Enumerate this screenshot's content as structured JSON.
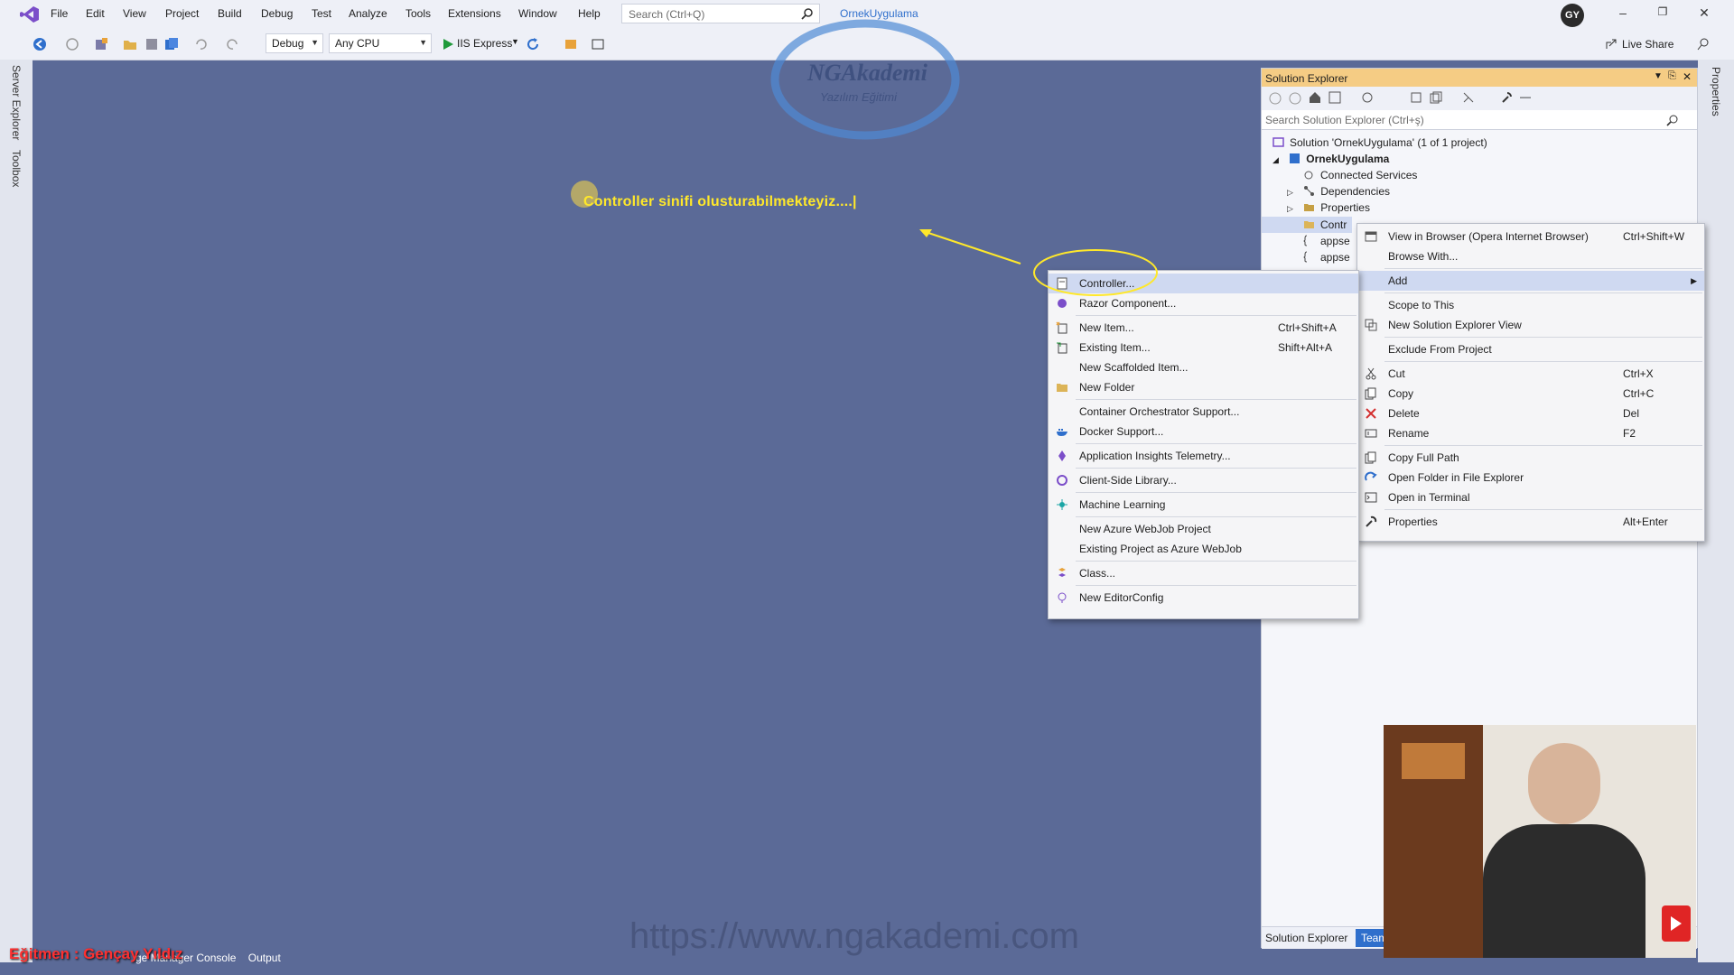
{
  "menu": {
    "file": "File",
    "edit": "Edit",
    "view": "View",
    "project": "Project",
    "build": "Build",
    "debug": "Debug",
    "test": "Test",
    "analyze": "Analyze",
    "tools": "Tools",
    "extensions": "Extensions",
    "window": "Window",
    "help": "Help"
  },
  "search": {
    "placeholder": "Search (Ctrl+Q)"
  },
  "solution_badge": "OrnekUygulama",
  "avatar_initials": "GY",
  "live_share": "Live Share",
  "toolbar": {
    "config": "Debug",
    "platform": "Any CPU",
    "run_target": "IIS Express"
  },
  "side_tabs": {
    "server_explorer": "Server Explorer",
    "toolbox": "Toolbox",
    "properties": "Properties"
  },
  "logo_text": {
    "title": "NGAkademi",
    "subtitle": "Yazılım Eğitimi"
  },
  "caption": "Controller sinifi olusturabilmekteyiz....|",
  "solution_explorer": {
    "title": "Solution Explorer",
    "search_placeholder": "Search Solution Explorer (Ctrl+ş)",
    "solution": "Solution 'OrnekUygulama' (1 of 1 project)",
    "project": "OrnekUygulama",
    "items": [
      "Connected Services",
      "Dependencies",
      "Properties",
      "Contr",
      "appse",
      "appse"
    ],
    "tab_active": "Solution Explorer",
    "tab_other": "Team"
  },
  "context_menu_main": [
    {
      "label": "View in Browser (Opera Internet Browser)",
      "shortcut": "Ctrl+Shift+W",
      "icon": "browser-icon"
    },
    {
      "label": "Browse With...",
      "shortcut": "",
      "icon": ""
    },
    {
      "label": "Add",
      "shortcut": "",
      "icon": ""
    },
    {
      "label": "Scope to This",
      "shortcut": "",
      "icon": ""
    },
    {
      "label": "New Solution Explorer View",
      "shortcut": "",
      "icon": "new-view-icon"
    },
    {
      "label": "Exclude From Project",
      "shortcut": "",
      "icon": ""
    },
    {
      "label": "Cut",
      "shortcut": "Ctrl+X",
      "icon": "cut-icon"
    },
    {
      "label": "Copy",
      "shortcut": "Ctrl+C",
      "icon": "copy-icon"
    },
    {
      "label": "Delete",
      "shortcut": "Del",
      "icon": "delete-icon"
    },
    {
      "label": "Rename",
      "shortcut": "F2",
      "icon": "rename-icon"
    },
    {
      "label": "Copy Full Path",
      "shortcut": "",
      "icon": "copy-path-icon"
    },
    {
      "label": "Open Folder in File Explorer",
      "shortcut": "",
      "icon": "open-folder-icon"
    },
    {
      "label": "Open in Terminal",
      "shortcut": "",
      "icon": "terminal-icon"
    },
    {
      "label": "Properties",
      "shortcut": "Alt+Enter",
      "icon": "wrench-icon"
    }
  ],
  "context_menu_add": [
    {
      "label": "Controller...",
      "shortcut": "",
      "icon": "controller-icon"
    },
    {
      "label": "Razor Component...",
      "shortcut": "",
      "icon": "razor-icon"
    },
    {
      "label": "New Item...",
      "shortcut": "Ctrl+Shift+A",
      "icon": "new-item-icon"
    },
    {
      "label": "Existing Item...",
      "shortcut": "Shift+Alt+A",
      "icon": "existing-item-icon"
    },
    {
      "label": "New Scaffolded Item...",
      "shortcut": "",
      "icon": ""
    },
    {
      "label": "New Folder",
      "shortcut": "",
      "icon": "folder-icon"
    },
    {
      "label": "Container Orchestrator Support...",
      "shortcut": "",
      "icon": ""
    },
    {
      "label": "Docker Support...",
      "shortcut": "",
      "icon": "docker-icon"
    },
    {
      "label": "Application Insights Telemetry...",
      "shortcut": "",
      "icon": "insights-icon"
    },
    {
      "label": "Client-Side Library...",
      "shortcut": "",
      "icon": "library-icon"
    },
    {
      "label": "Machine Learning",
      "shortcut": "",
      "icon": "ml-icon"
    },
    {
      "label": "New Azure WebJob Project",
      "shortcut": "",
      "icon": ""
    },
    {
      "label": "Existing Project as Azure WebJob",
      "shortcut": "",
      "icon": ""
    },
    {
      "label": "Class...",
      "shortcut": "",
      "icon": "class-icon"
    },
    {
      "label": "New EditorConfig",
      "shortcut": "",
      "icon": "editorconfig-icon"
    }
  ],
  "watermark": "https://www.ngakademi.com",
  "instructor": "Eğitmen : Gençay Yıldız",
  "bottom_tabs": {
    "package_manager": "ge Manager Console",
    "output": "Output"
  },
  "colors": {
    "background": "#5b6a97",
    "caption": "#ffe82a",
    "se_title": "#f5cc84",
    "highlight": "#cfd9f1"
  }
}
